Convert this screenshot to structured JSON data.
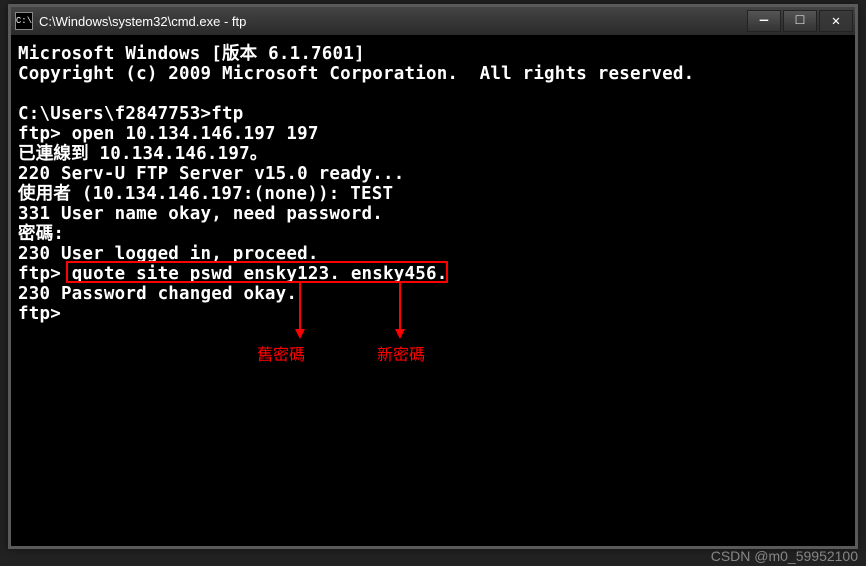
{
  "window": {
    "title": "C:\\Windows\\system32\\cmd.exe - ftp",
    "icon_label": "C:\\"
  },
  "controls": {
    "min": "—",
    "max": "□",
    "close": "✕"
  },
  "terminal_lines": {
    "l0": "Microsoft Windows [版本 6.1.7601]",
    "l1": "Copyright (c) 2009 Microsoft Corporation.  All rights reserved.",
    "l2": "",
    "l3": "C:\\Users\\f2847753>ftp",
    "l4": "ftp> open 10.134.146.197 197",
    "l5": "已連線到 10.134.146.197。",
    "l6": "220 Serv-U FTP Server v15.0 ready...",
    "l7": "使用者 (10.134.146.197:(none)): TEST",
    "l8": "331 User name okay, need password.",
    "l9": "密碼:",
    "l10": "230 User logged in, proceed.",
    "l11_prompt": "ftp> ",
    "l11_cmd": "quote site pswd ensky123. ensky456.",
    "l12": "230 Password changed okay.",
    "l13": "ftp>"
  },
  "annotations": {
    "old_pwd": "舊密碼",
    "new_pwd": "新密碼"
  },
  "watermark": "CSDN @m0_59952100"
}
